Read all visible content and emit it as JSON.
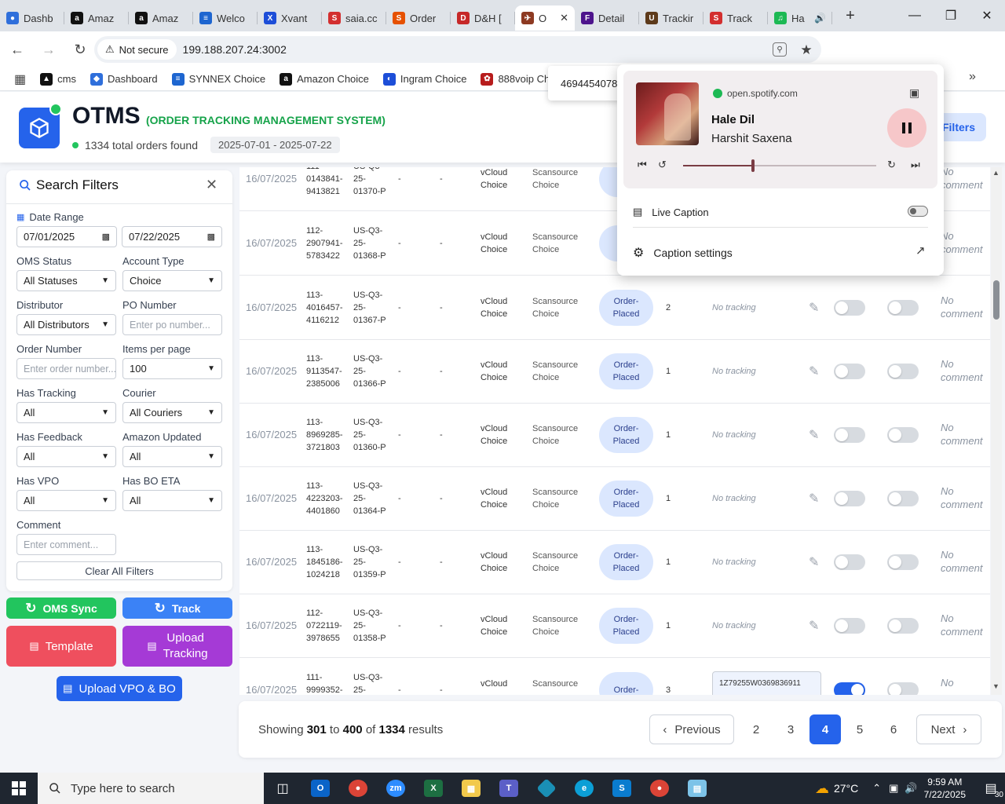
{
  "browser": {
    "tabs": [
      {
        "label": "Dashb",
        "fav_color": "#2f6fdb",
        "fav_glyph": "●"
      },
      {
        "label": "Amaz",
        "fav_color": "#111111",
        "fav_glyph": "a"
      },
      {
        "label": "Amaz",
        "fav_color": "#111111",
        "fav_glyph": "a"
      },
      {
        "label": "Welco",
        "fav_color": "#1e66d0",
        "fav_glyph": "≡"
      },
      {
        "label": "Xvant",
        "fav_color": "#1d4ed8",
        "fav_glyph": "X"
      },
      {
        "label": "saia.cc",
        "fav_color": "#d32f2f",
        "fav_glyph": "S"
      },
      {
        "label": "Order",
        "fav_color": "#e65100",
        "fav_glyph": "S"
      },
      {
        "label": "D&H [",
        "fav_color": "#c62828",
        "fav_glyph": "D"
      },
      {
        "label": "O",
        "fav_color": "#8d3a22",
        "fav_glyph": "✈",
        "active": true
      },
      {
        "label": "Detail",
        "fav_color": "#4d148c",
        "fav_glyph": "F"
      },
      {
        "label": "Trackir",
        "fav_color": "#5d3a1a",
        "fav_glyph": "U"
      },
      {
        "label": "Track",
        "fav_color": "#d32f2f",
        "fav_glyph": "S"
      },
      {
        "label": "Ha",
        "fav_color": "#1db954",
        "fav_glyph": "♫"
      }
    ],
    "not_secure": "Not secure",
    "url": "199.188.207.24:3002",
    "profile_initial": "f",
    "bookmarks": [
      {
        "label": "cms",
        "color": "#111111",
        "glyph": "▲"
      },
      {
        "label": "Dashboard",
        "color": "#2f6fdb",
        "glyph": "◆"
      },
      {
        "label": "SYNNEX Choice",
        "color": "#1e66d0",
        "glyph": "≡"
      },
      {
        "label": "Amazon Choice",
        "color": "#111111",
        "glyph": "a"
      },
      {
        "label": "Ingram Choice",
        "color": "#1d4ed8",
        "glyph": "◐"
      },
      {
        "label": "888voip Choice",
        "color": "#b71c1c",
        "glyph": "✿"
      }
    ],
    "overflow_number": "469445407802"
  },
  "app": {
    "brand": "OTMS",
    "subtitle": "(ORDER TRACKING MANAGEMENT SYSTEM)",
    "orders_found": "1334 total orders found",
    "date_pill": "2025-07-01 - 2025-07-22",
    "filters_button": "Filters"
  },
  "filters": {
    "title": "Search Filters",
    "date_range_label": "Date Range",
    "date_from": "07/01/2025",
    "date_to": "07/22/2025",
    "oms_status_label": "OMS Status",
    "oms_status_value": "All Statuses",
    "account_type_label": "Account Type",
    "account_type_value": "Choice",
    "distributor_label": "Distributor",
    "distributor_value": "All Distributors",
    "po_number_label": "PO Number",
    "po_number_placeholder": "Enter po number...",
    "order_number_label": "Order Number",
    "order_number_placeholder": "Enter order number...",
    "items_per_page_label": "Items per page",
    "items_per_page_value": "100",
    "has_tracking_label": "Has Tracking",
    "has_tracking_value": "All",
    "courier_label": "Courier",
    "courier_value": "All Couriers",
    "has_feedback_label": "Has Feedback",
    "has_feedback_value": "All",
    "amazon_updated_label": "Amazon Updated",
    "amazon_updated_value": "All",
    "has_vpo_label": "Has VPO",
    "has_vpo_value": "All",
    "has_bo_eta_label": "Has BO ETA",
    "has_bo_eta_value": "All",
    "comment_label": "Comment",
    "comment_placeholder": "Enter comment...",
    "clear_button": "Clear All Filters"
  },
  "actions": {
    "oms_sync": "OMS Sync",
    "track": "Track",
    "template": "Template",
    "upload_tracking_1": "Upload",
    "upload_tracking_2": "Tracking",
    "upload_vpo": "Upload VPO & BO"
  },
  "rows": [
    {
      "date": "16/07/2025",
      "order": [
        "111-",
        "0143841-",
        "9413821"
      ],
      "po": [
        "US-Q3-",
        "25-",
        "01370-P"
      ],
      "d1": "-",
      "d2": "-",
      "account": [
        "vCloud",
        "Choice"
      ],
      "dist": [
        "Scansource",
        "Choice"
      ],
      "status": [
        "Or",
        "Pl"
      ],
      "qty": "",
      "tracking": "",
      "t1": false,
      "t2": false,
      "comment": [
        "No",
        "comment"
      ]
    },
    {
      "date": "16/07/2025",
      "order": [
        "112-",
        "2907941-",
        "5783422"
      ],
      "po": [
        "US-Q3-",
        "25-",
        "01368-P"
      ],
      "d1": "-",
      "d2": "-",
      "account": [
        "vCloud",
        "Choice"
      ],
      "dist": [
        "Scansource",
        "Choice"
      ],
      "status": [
        "Or",
        "Pl"
      ],
      "qty": "",
      "tracking": "",
      "t1": false,
      "t2": false,
      "comment": [
        "No",
        "comment"
      ]
    },
    {
      "date": "16/07/2025",
      "order": [
        "113-",
        "4016457-",
        "4116212"
      ],
      "po": [
        "US-Q3-",
        "25-",
        "01367-P"
      ],
      "d1": "-",
      "d2": "-",
      "account": [
        "vCloud",
        "Choice"
      ],
      "dist": [
        "Scansource",
        "Choice"
      ],
      "status": [
        "Order-",
        "Placed"
      ],
      "qty": "2",
      "tracking": "No tracking",
      "t1": false,
      "t2": false,
      "comment": [
        "No",
        "comment"
      ]
    },
    {
      "date": "16/07/2025",
      "order": [
        "113-",
        "9113547-",
        "2385006"
      ],
      "po": [
        "US-Q3-",
        "25-",
        "01366-P"
      ],
      "d1": "-",
      "d2": "-",
      "account": [
        "vCloud",
        "Choice"
      ],
      "dist": [
        "Scansource",
        "Choice"
      ],
      "status": [
        "Order-",
        "Placed"
      ],
      "qty": "1",
      "tracking": "No tracking",
      "t1": false,
      "t2": false,
      "comment": [
        "No",
        "comment"
      ]
    },
    {
      "date": "16/07/2025",
      "order": [
        "113-",
        "8969285-",
        "3721803"
      ],
      "po": [
        "US-Q3-",
        "25-",
        "01360-P"
      ],
      "d1": "-",
      "d2": "-",
      "account": [
        "vCloud",
        "Choice"
      ],
      "dist": [
        "Scansource",
        "Choice"
      ],
      "status": [
        "Order-",
        "Placed"
      ],
      "qty": "1",
      "tracking": "No tracking",
      "t1": false,
      "t2": false,
      "comment": [
        "No",
        "comment"
      ]
    },
    {
      "date": "16/07/2025",
      "order": [
        "113-",
        "4223203-",
        "4401860"
      ],
      "po": [
        "US-Q3-",
        "25-",
        "01364-P"
      ],
      "d1": "-",
      "d2": "-",
      "account": [
        "vCloud",
        "Choice"
      ],
      "dist": [
        "Scansource",
        "Choice"
      ],
      "status": [
        "Order-",
        "Placed"
      ],
      "qty": "1",
      "tracking": "No tracking",
      "t1": false,
      "t2": false,
      "comment": [
        "No",
        "comment"
      ]
    },
    {
      "date": "16/07/2025",
      "order": [
        "113-",
        "1845186-",
        "1024218"
      ],
      "po": [
        "US-Q3-",
        "25-",
        "01359-P"
      ],
      "d1": "-",
      "d2": "-",
      "account": [
        "vCloud",
        "Choice"
      ],
      "dist": [
        "Scansource",
        "Choice"
      ],
      "status": [
        "Order-",
        "Placed"
      ],
      "qty": "1",
      "tracking": "No tracking",
      "t1": false,
      "t2": false,
      "comment": [
        "No",
        "comment"
      ]
    },
    {
      "date": "16/07/2025",
      "order": [
        "112-",
        "0722119-",
        "3978655"
      ],
      "po": [
        "US-Q3-",
        "25-",
        "01358-P"
      ],
      "d1": "-",
      "d2": "-",
      "account": [
        "vCloud",
        "Choice"
      ],
      "dist": [
        "Scansource",
        "Choice"
      ],
      "status": [
        "Order-",
        "Placed"
      ],
      "qty": "1",
      "tracking": "No tracking",
      "t1": false,
      "t2": false,
      "comment": [
        "No",
        "comment"
      ]
    },
    {
      "date": "16/07/2025",
      "order": [
        "111-",
        "9999352-",
        ""
      ],
      "po": [
        "US-Q3-",
        "25-",
        ""
      ],
      "d1": "-",
      "d2": "-",
      "account": [
        "vCloud",
        ""
      ],
      "dist": [
        "Scansource",
        ""
      ],
      "status": [
        "Order-",
        ""
      ],
      "qty": "3",
      "tracking": "1Z79255W0369836911",
      "t1": true,
      "t2": false,
      "comment": [
        "No",
        ""
      ]
    }
  ],
  "pagination": {
    "showing_prefix": "Showing",
    "from": "301",
    "to_word": "to",
    "to": "400",
    "of_word": "of",
    "total": "1334",
    "results_word": "results",
    "previous": "Previous",
    "next": "Next",
    "pages": [
      "2",
      "3",
      "4",
      "5",
      "6"
    ],
    "current": "4"
  },
  "media": {
    "source": "open.spotify.com",
    "song": "Hale Dil",
    "artist": "Harshit Saxena",
    "progress": 0.36,
    "live_caption": "Live Caption",
    "caption_settings": "Caption settings"
  },
  "taskbar": {
    "search_placeholder": "Type here to search",
    "temperature": "27°C",
    "time": "9:59 AM",
    "date": "7/22/2025",
    "notifications": "30"
  }
}
